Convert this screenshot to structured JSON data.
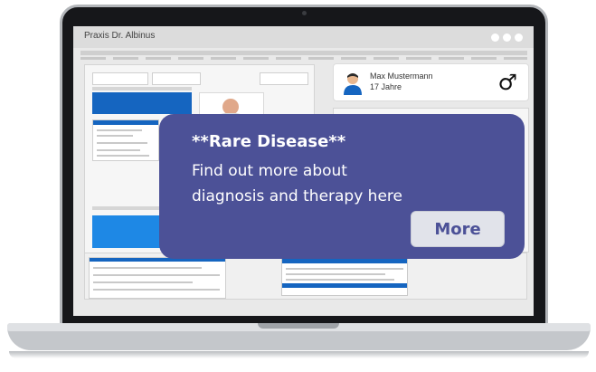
{
  "app": {
    "title": "Praxis Dr. Albinus"
  },
  "patient": {
    "name": "Max Mustermann",
    "age": "17 Jahre",
    "sex_symbol": "♂"
  },
  "promo": {
    "title": "**Rare Disease**",
    "body": "Find out more about diagnosis and therapy here",
    "button_label": "More"
  },
  "colors": {
    "overlay": "#4c5197",
    "button_bg": "#e1e3ea",
    "accent_blue": "#1565c0"
  },
  "icons": {
    "avatar": "person-avatar-icon",
    "sex": "male-symbol-icon"
  }
}
